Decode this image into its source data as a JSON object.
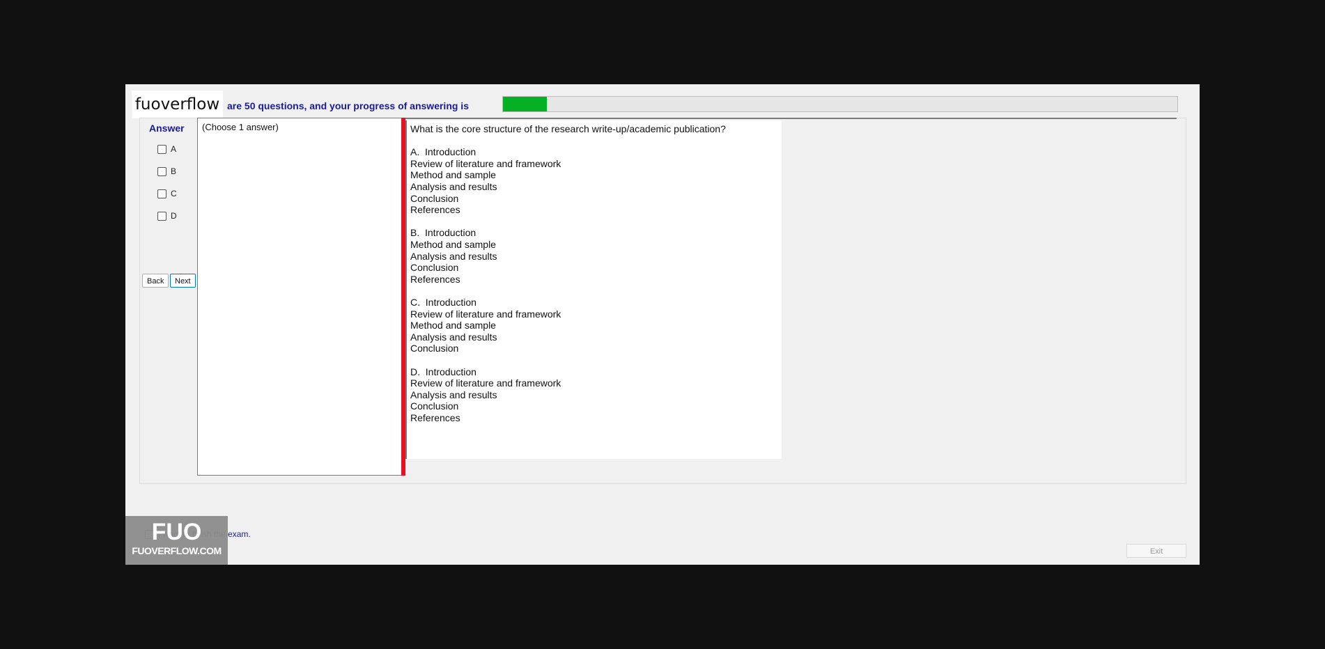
{
  "header": {
    "watermark_text": "fuoverflow",
    "progress_label": "are 50 questions, and your progress of answering is",
    "progress_fraction": 0.065
  },
  "answer_panel": {
    "title": "Answer",
    "options": [
      "A",
      "B",
      "C",
      "D"
    ],
    "back_label": "Back",
    "next_label": "Next"
  },
  "choose_panel": {
    "hint": "(Choose 1 answer)"
  },
  "question": {
    "lines": [
      "What is the core structure of the research write-up/academic publication?",
      "",
      "A.  Introduction",
      "Review of literature and framework",
      "Method and sample",
      "Analysis and results",
      "Conclusion",
      "References",
      "",
      "B.  Introduction",
      "Method and sample",
      "Analysis and results",
      "Conclusion",
      "References",
      "",
      "C.  Introduction",
      "Review of literature and framework",
      "Method and sample",
      "Analysis and results",
      "Conclusion",
      "",
      "D.  Introduction",
      "Review of literature and framework",
      "Analysis and results",
      "Conclusion",
      "References"
    ]
  },
  "footer": {
    "finish_label": "I want to finish the exam.",
    "exit_label": "Exit",
    "logo_mark": "FUO",
    "logo_site": "FUOVERFLOW.COM"
  },
  "colors": {
    "progress_fill": "#06b025",
    "splitter": "#e81123",
    "label_blue": "#1a1a9a"
  }
}
